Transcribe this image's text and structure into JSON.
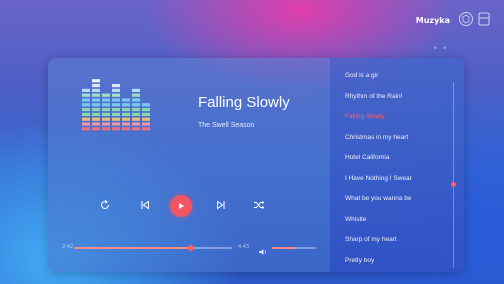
{
  "app": {
    "title": "Muzyka",
    "icons": [
      "theme-icon",
      "playlist-icon"
    ]
  },
  "colors": {
    "accent": "#ff5f6d",
    "play_button": "#f05662",
    "text": "#ffffff"
  },
  "now_playing": {
    "title": "Falling Slowly",
    "artist": "The Swell Season"
  },
  "controls": {
    "icons": [
      "repeat-icon",
      "previous-icon",
      "play-icon",
      "next-icon",
      "shuffle-icon"
    ]
  },
  "progress": {
    "elapsed": "2:42",
    "total": "4:43",
    "fraction": 0.74
  },
  "volume": {
    "icon": "volume-icon",
    "fraction": 0.55
  },
  "playlist": {
    "items": [
      {
        "label": "God is a gir",
        "active": false
      },
      {
        "label": "Rhythm of the Rain!",
        "active": false
      },
      {
        "label": "Falling Slowly",
        "active": true
      },
      {
        "label": "Christmas in my heart",
        "active": false
      },
      {
        "label": "Hotel California",
        "active": false
      },
      {
        "label": "I Have Nothing I Swear",
        "active": false
      },
      {
        "label": "What be you wanna be",
        "active": false
      },
      {
        "label": "Whistle",
        "active": false
      },
      {
        "label": "Sharp of my heart",
        "active": false
      },
      {
        "label": "Pretty boy",
        "active": false
      }
    ],
    "scroll_position": 0.55
  }
}
